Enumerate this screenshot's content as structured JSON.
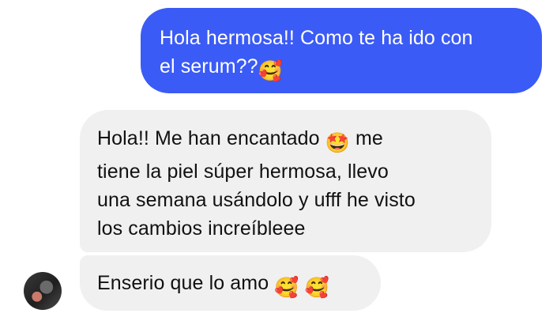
{
  "messages": [
    {
      "direction": "outgoing",
      "lines": [
        "Hola hermosa!! Como te ha ido con",
        "el serum??"
      ],
      "trailing_emoji": "🥰"
    },
    {
      "direction": "incoming",
      "lines": [
        "Hola!! Me han encantado",
        "me",
        "tiene la piel súper hermosa, llevo",
        "una semana usándolo y ufff he visto",
        "los cambios increíbleee"
      ],
      "inline_emoji": "🤩"
    },
    {
      "direction": "incoming",
      "text": "Enserio que lo amo",
      "emojis": [
        "🥰",
        "🥰"
      ]
    }
  ],
  "colors": {
    "outgoing_bubble": "#3b5bf6",
    "incoming_bubble": "#f0f0f0"
  },
  "icons": {
    "avatar": "contact-avatar"
  }
}
